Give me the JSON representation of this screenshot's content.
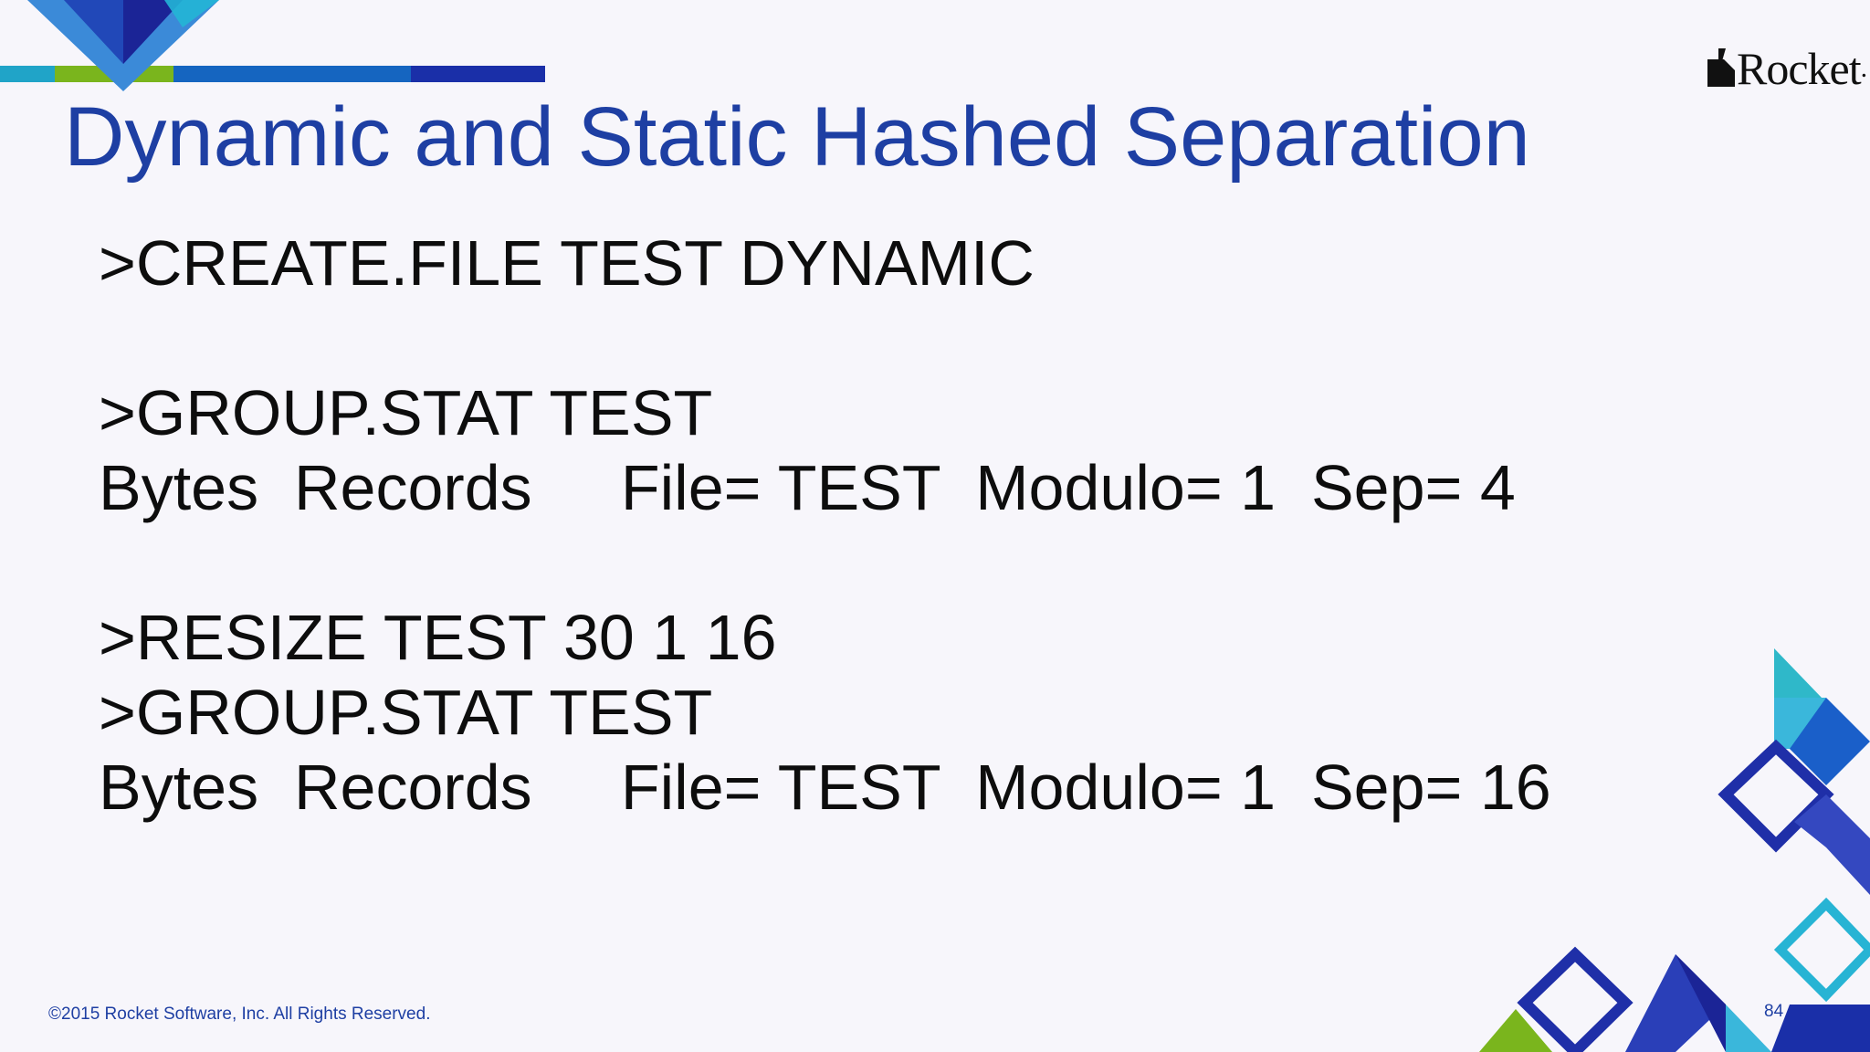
{
  "slide": {
    "title": "Dynamic and Static Hashed Separation",
    "logo_text": "Rocket",
    "logo_icon": "rocket-logo-mark",
    "accent_color": "#1e3fa3",
    "body_lines": [
      ">CREATE.FILE TEST DYNAMIC",
      ">GROUP.STAT TEST",
      "Bytes  Records     File= TEST  Modulo= 1  Sep= 4",
      ">RESIZE TEST 30 1 16",
      ">GROUP.STAT TEST",
      "Bytes  Records     File= TEST  Modulo= 1  Sep= 16"
    ],
    "footer": "©2015 Rocket Software, Inc. All Rights Reserved.",
    "page_number": "84"
  }
}
